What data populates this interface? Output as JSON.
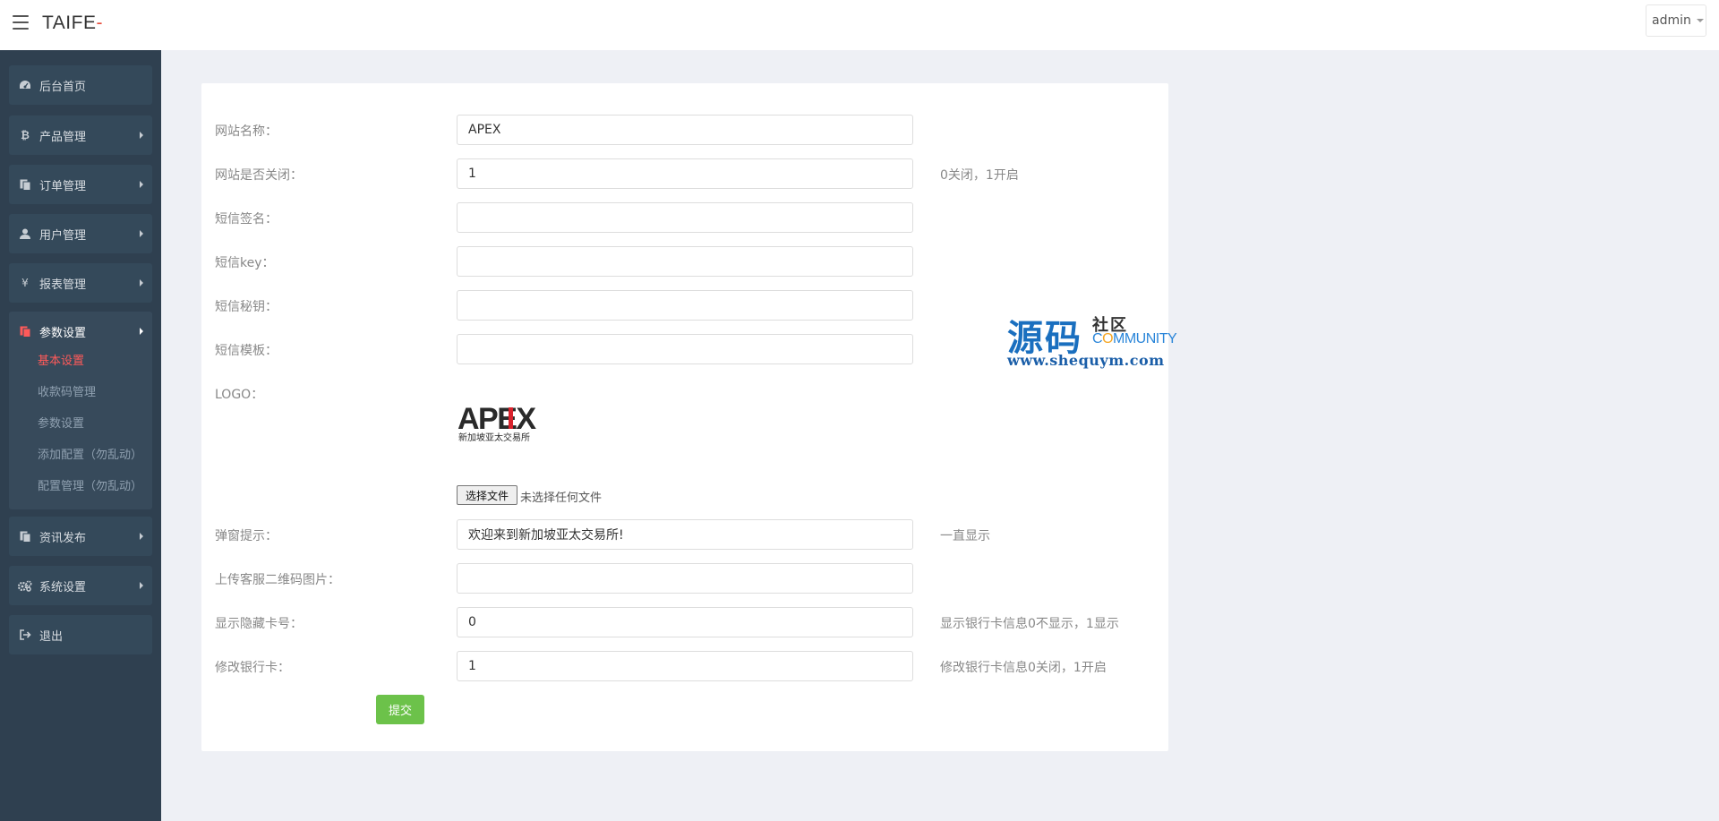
{
  "header": {
    "brand": "TAIFE",
    "brand_suffix": "-",
    "user": "admin"
  },
  "sidebar": {
    "items": [
      {
        "label": "后台首页",
        "icon": "dashboard-icon"
      },
      {
        "label": "产品管理",
        "icon": "bitcoin-icon"
      },
      {
        "label": "订单管理",
        "icon": "copy-icon"
      },
      {
        "label": "用户管理",
        "icon": "user-icon"
      },
      {
        "label": "报表管理",
        "icon": "yen-icon"
      },
      {
        "label": "参数设置",
        "icon": "copy-icon"
      },
      {
        "label": "资讯发布",
        "icon": "copy-icon"
      },
      {
        "label": "系统设置",
        "icon": "gears-icon"
      },
      {
        "label": "退出",
        "icon": "sign-out-icon"
      }
    ],
    "submenu": [
      {
        "label": "基本设置",
        "active": true
      },
      {
        "label": "收款码管理",
        "active": false
      },
      {
        "label": "参数设置",
        "active": false
      },
      {
        "label": "添加配置（勿乱动）",
        "active": false
      },
      {
        "label": "配置管理（勿乱动）",
        "active": false
      }
    ]
  },
  "form": {
    "rows": [
      {
        "label": "网站名称：",
        "value": "APEX",
        "hint": ""
      },
      {
        "label": "网站是否关闭：",
        "value": "1",
        "hint": "0关闭，1开启"
      },
      {
        "label": "短信签名：",
        "value": "",
        "hint": ""
      },
      {
        "label": "短信key：",
        "value": "",
        "hint": ""
      },
      {
        "label": "短信秘钥：",
        "value": "",
        "hint": ""
      },
      {
        "label": "短信模板：",
        "value": "",
        "hint": ""
      }
    ],
    "logo": {
      "label": "LOGO：",
      "image_text": "APEX",
      "image_subtext": "新加坡亚太交易所",
      "file_button": "选择文件",
      "file_status": "未选择任何文件"
    },
    "rows2": [
      {
        "label": "弹窗提示：",
        "value": "欢迎来到新加坡亚太交易所!",
        "hint": "一直显示"
      },
      {
        "label": "上传客服二维码图片：",
        "value": "",
        "hint": ""
      },
      {
        "label": "显示隐藏卡号：",
        "value": "0",
        "hint": "显示银行卡信息0不显示，1显示"
      },
      {
        "label": "修改银行卡：",
        "value": "1",
        "hint": "修改银行卡信息0关闭，1开启"
      }
    ],
    "submit": "提交"
  },
  "watermark": {
    "big": "源码",
    "small": "社区",
    "community_pre": "C",
    "community_o": "O",
    "community_post": "MMUNITY",
    "url": "www.shequym.com"
  },
  "colors": {
    "sidebar_bg": "#2f4050",
    "accent_red": "#ff5a5a",
    "submit_green": "#6cc24a"
  }
}
